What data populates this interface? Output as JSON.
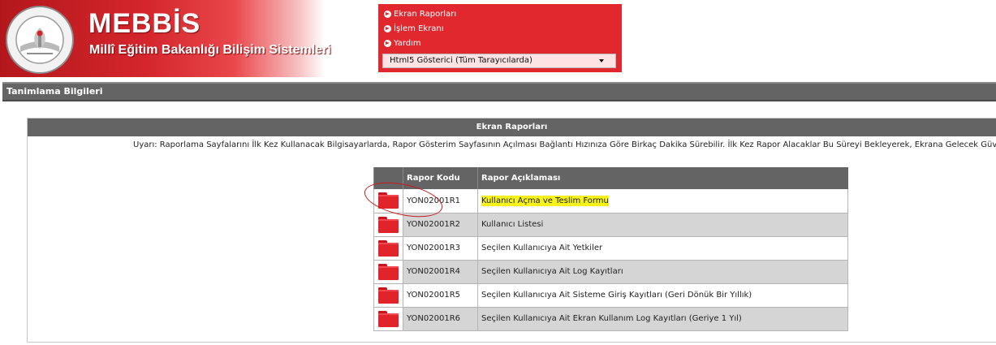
{
  "header": {
    "brand": "MEBBİS",
    "subtitle": "Millî Eğitim Bakanlığı Bilişim Sistemleri",
    "logo_text": "T.C. MİLLÎ EĞİTİM BAKANLIĞI",
    "colors": {
      "banner": "#d4262c",
      "menu": "#e0282e"
    }
  },
  "menu": {
    "items": [
      {
        "label": "Ekran Raporları",
        "icon": "arrow-circle-icon"
      },
      {
        "label": "İşlem Ekranı",
        "icon": "arrow-circle-icon"
      },
      {
        "label": "Yardım",
        "icon": "arrow-circle-icon"
      }
    ],
    "viewer_select": {
      "value": "Html5 Gösterici (Tüm Tarayıcılarda)",
      "icon": "chevron-down-icon"
    }
  },
  "titlebar": {
    "text": "Tanimlama Bilgileri"
  },
  "panel": {
    "title": "Ekran Raporları",
    "warning": "Uyarı: Raporlama Sayfalarını İlk Kez Kullanacak Bilgisayarlarda, Rapor Gösterim Sayfasının Açılması Bağlantı Hızınıza Göre Birkaç Dakika Sürebilir. İlk Kez Rapor Alacaklar Bu Süreyi Bekleyerek, Ekrana Gelecek Güvenlik Uya"
  },
  "table": {
    "headers": [
      "",
      "Rapor Kodu",
      "Rapor Açıklaması"
    ],
    "rows": [
      {
        "code": "YON02001R1",
        "desc": "Kullanıcı Açma ve Teslim Formu",
        "icon": "folder-icon"
      },
      {
        "code": "YON02001R2",
        "desc": "Kullanıcı Listesi",
        "icon": "folder-icon"
      },
      {
        "code": "YON02001R3",
        "desc": "Seçilen Kullanıcıya Ait Yetkiler",
        "icon": "folder-icon"
      },
      {
        "code": "YON02001R4",
        "desc": "Seçilen Kullanıcıya Ait Log Kayıtları",
        "icon": "folder-icon"
      },
      {
        "code": "YON02001R5",
        "desc": "Seçilen Kullanıcıya Ait Sisteme Giriş Kayıtları (Geri Dönük Bir Yıllık)",
        "icon": "folder-icon"
      },
      {
        "code": "YON02001R6",
        "desc": "Seçilen Kullanıcıya Ait Ekran Kullanım Log Kayıtları (Geriye 1 Yıl)",
        "icon": "folder-icon"
      }
    ]
  }
}
